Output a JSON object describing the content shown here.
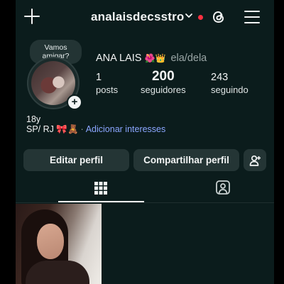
{
  "header": {
    "username": "analaisdecsstro",
    "icons": [
      "plus-icon",
      "chevron-down-icon",
      "threads-icon",
      "menu-icon"
    ],
    "notification_color": "#ff3040"
  },
  "profile": {
    "note": "Vamos amigar?",
    "note_line1": "Vamos",
    "note_line2": "amigar?",
    "display_name": "ANA LAIS",
    "display_name_emoji": "🌺👑",
    "pronouns": "ela/dela",
    "stats": [
      {
        "value": "1",
        "label": "posts"
      },
      {
        "value": "200",
        "label": "seguidores"
      },
      {
        "value": "243",
        "label": "seguindo"
      }
    ],
    "bio_line1": "18y",
    "bio_line2": "SP/ RJ",
    "bio_line2_emoji": "🎀🧸",
    "interests_link": "Adicionar interesses"
  },
  "actions": {
    "edit": "Editar perfil",
    "share": "Compartilhar perfil"
  },
  "tabs": [
    {
      "name": "posts-grid",
      "icon": "grid-icon",
      "active": true
    },
    {
      "name": "tagged",
      "icon": "tagged-person-icon",
      "active": false
    }
  ],
  "colors": {
    "background": "#0b1c1c",
    "button": "#243535",
    "link": "#8ba6ff"
  }
}
